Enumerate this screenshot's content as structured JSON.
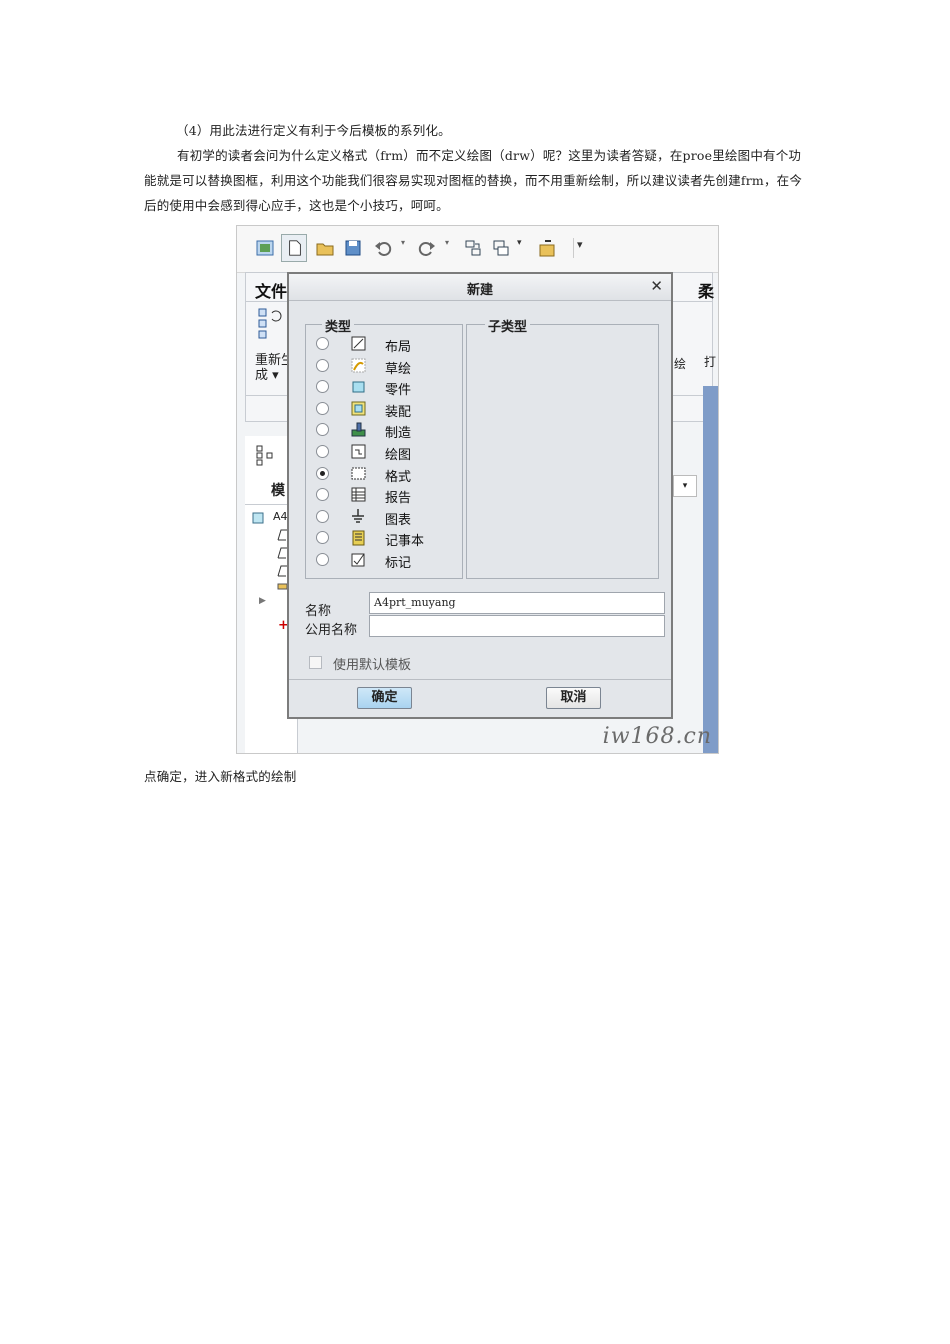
{
  "doc": {
    "p1": "（4）用此法进行定义有利于今后模板的系列化。",
    "p2": "有初学的读者会问为什么定义格式（frm）而不定义绘图（drw）呢？这里为读者答疑，在proe里绘图中有个功能就是可以替换图框，利用这个功能我们很容易实现对图框的替换，而不用重新绘制，所以建议读者先创建frm，在今后的使用中会感到得心应手，这也是个小技巧，呵呵。",
    "p3": "点确定，进入新格式的绘制"
  },
  "background_app": {
    "tab_file": "文件",
    "tab_right": "柔",
    "regen_line1": "重新生",
    "regen_line2": "成 ▾",
    "nav_tree_header": "模",
    "tree_item": "A4",
    "right_side_text": "绘",
    "right_side_text2": "打"
  },
  "dialog": {
    "title": "新建",
    "close_glyph": "✕",
    "type_group_label": "类型",
    "subtype_group_label": "子类型",
    "types": [
      {
        "label": "布局",
        "icon": "layout-icon",
        "selected": false
      },
      {
        "label": "草绘",
        "icon": "sketch-icon",
        "selected": false
      },
      {
        "label": "零件",
        "icon": "part-icon",
        "selected": false
      },
      {
        "label": "装配",
        "icon": "assembly-icon",
        "selected": false
      },
      {
        "label": "制造",
        "icon": "manufacturing-icon",
        "selected": false
      },
      {
        "label": "绘图",
        "icon": "drawing-icon",
        "selected": false
      },
      {
        "label": "格式",
        "icon": "format-icon",
        "selected": true
      },
      {
        "label": "报告",
        "icon": "report-icon",
        "selected": false
      },
      {
        "label": "图表",
        "icon": "diagram-icon",
        "selected": false
      },
      {
        "label": "记事本",
        "icon": "notebook-icon",
        "selected": false
      },
      {
        "label": "标记",
        "icon": "markup-icon",
        "selected": false
      }
    ],
    "name_label": "名称",
    "name_value": "A4prt_muyang",
    "common_name_label": "公用名称",
    "common_name_value": "",
    "use_default_template_label": "使用默认模板",
    "ok_label": "确定",
    "cancel_label": "取消"
  },
  "watermark": "iw168.cn"
}
